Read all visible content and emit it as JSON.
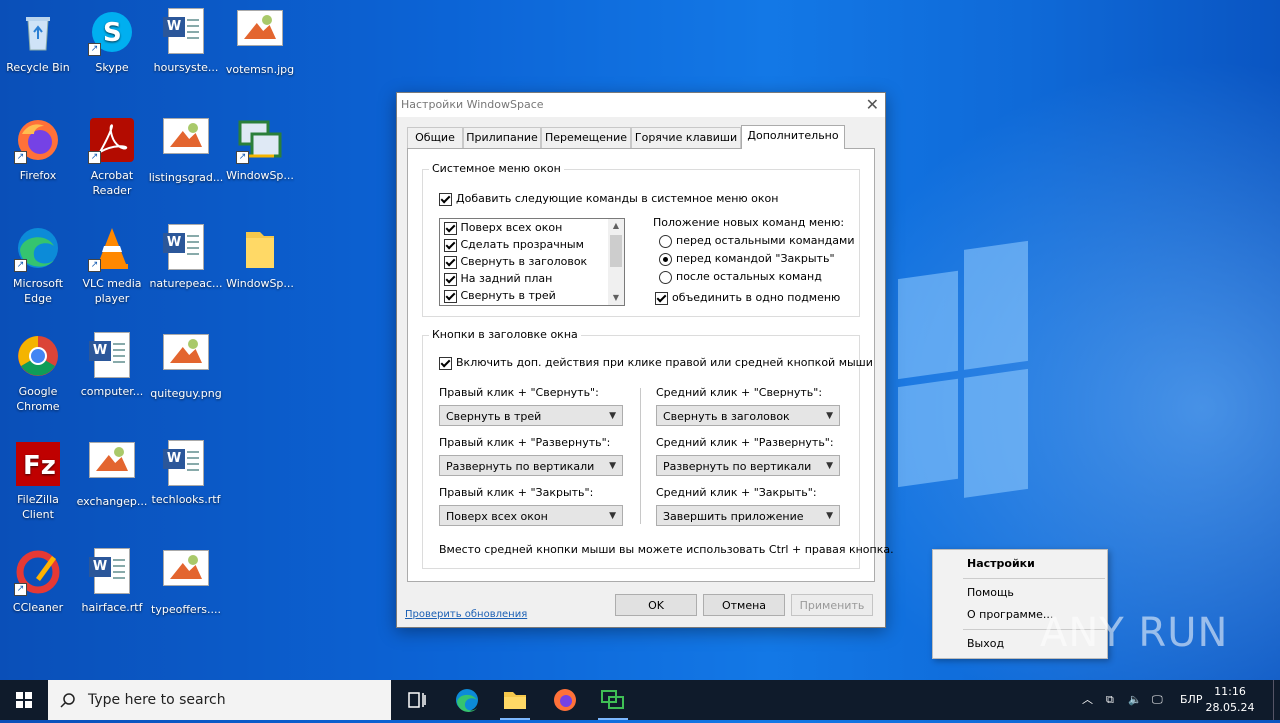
{
  "desktop": {
    "icons": [
      {
        "label": "Recycle Bin"
      },
      {
        "label": "Skype"
      },
      {
        "label": "hoursyste..."
      },
      {
        "label": "votemsn.jpg"
      },
      {
        "label": "Firefox"
      },
      {
        "label": "Acrobat Reader"
      },
      {
        "label": "listingsgrad..."
      },
      {
        "label": "WindowSp..."
      },
      {
        "label": "Microsoft Edge"
      },
      {
        "label": "VLC media player"
      },
      {
        "label": "naturepeac..."
      },
      {
        "label": "WindowSp..."
      },
      {
        "label": "Google Chrome"
      },
      {
        "label": "computer..."
      },
      {
        "label": "quiteguy.png"
      },
      {
        "label": "FileZilla Client"
      },
      {
        "label": "exchangep..."
      },
      {
        "label": "techlooks.rtf"
      },
      {
        "label": "CCleaner"
      },
      {
        "label": "hairface.rtf"
      },
      {
        "label": "typeoffers...."
      }
    ]
  },
  "dialog": {
    "title": "Настройки WindowSpace",
    "tabs": [
      "Общие",
      "Прилипание",
      "Перемещение",
      "Горячие клавиши",
      "Дополнительно"
    ],
    "system_menu": {
      "group_label": "Системное меню окон",
      "add_commands_label": "Добавить следующие команды в системное меню окон",
      "list_items": [
        "Поверх всех окон",
        "Сделать прозрачным",
        "Свернуть в заголовок",
        "На задний план",
        "Свернуть в трей"
      ],
      "position_label": "Положение новых команд меню:",
      "radios": [
        "перед остальными командами",
        "перед командой \"Закрыть\"",
        "после остальных команд"
      ],
      "selected_radio": 1,
      "merge_label": "объединить в одно подменю"
    },
    "title_buttons": {
      "group_label": "Кнопки в заголовке окна",
      "enable_label": "Включить доп. действия при клике правой или средней кнопкой мыши",
      "right_min_label": "Правый клик + \"Свернуть\":",
      "right_min_value": "Свернуть в трей",
      "right_max_label": "Правый клик + \"Развернуть\":",
      "right_max_value": "Развернуть по вертикали",
      "right_close_label": "Правый клик + \"Закрыть\":",
      "right_close_value": "Поверх всех окон",
      "mid_min_label": "Средний клик + \"Свернуть\":",
      "mid_min_value": "Свернуть в заголовок",
      "mid_max_label": "Средний клик + \"Развернуть\":",
      "mid_max_value": "Развернуть по вертикали",
      "mid_close_label": "Средний клик + \"Закрыть\":",
      "mid_close_value": "Завершить приложение",
      "hint": "Вместо средней кнопки мыши вы можете использовать Ctrl + правая кнопка."
    },
    "update_link": "Проверить обновления",
    "ok": "OK",
    "cancel": "Отмена",
    "apply": "Применить"
  },
  "context_menu": {
    "items": [
      "Настройки",
      "Помощь",
      "О программе...",
      "Выход"
    ]
  },
  "taskbar": {
    "search_placeholder": "Type here to search",
    "language": "БЛР",
    "time": "11:16",
    "date": "28.05.24"
  },
  "watermark": "ANY RUN"
}
